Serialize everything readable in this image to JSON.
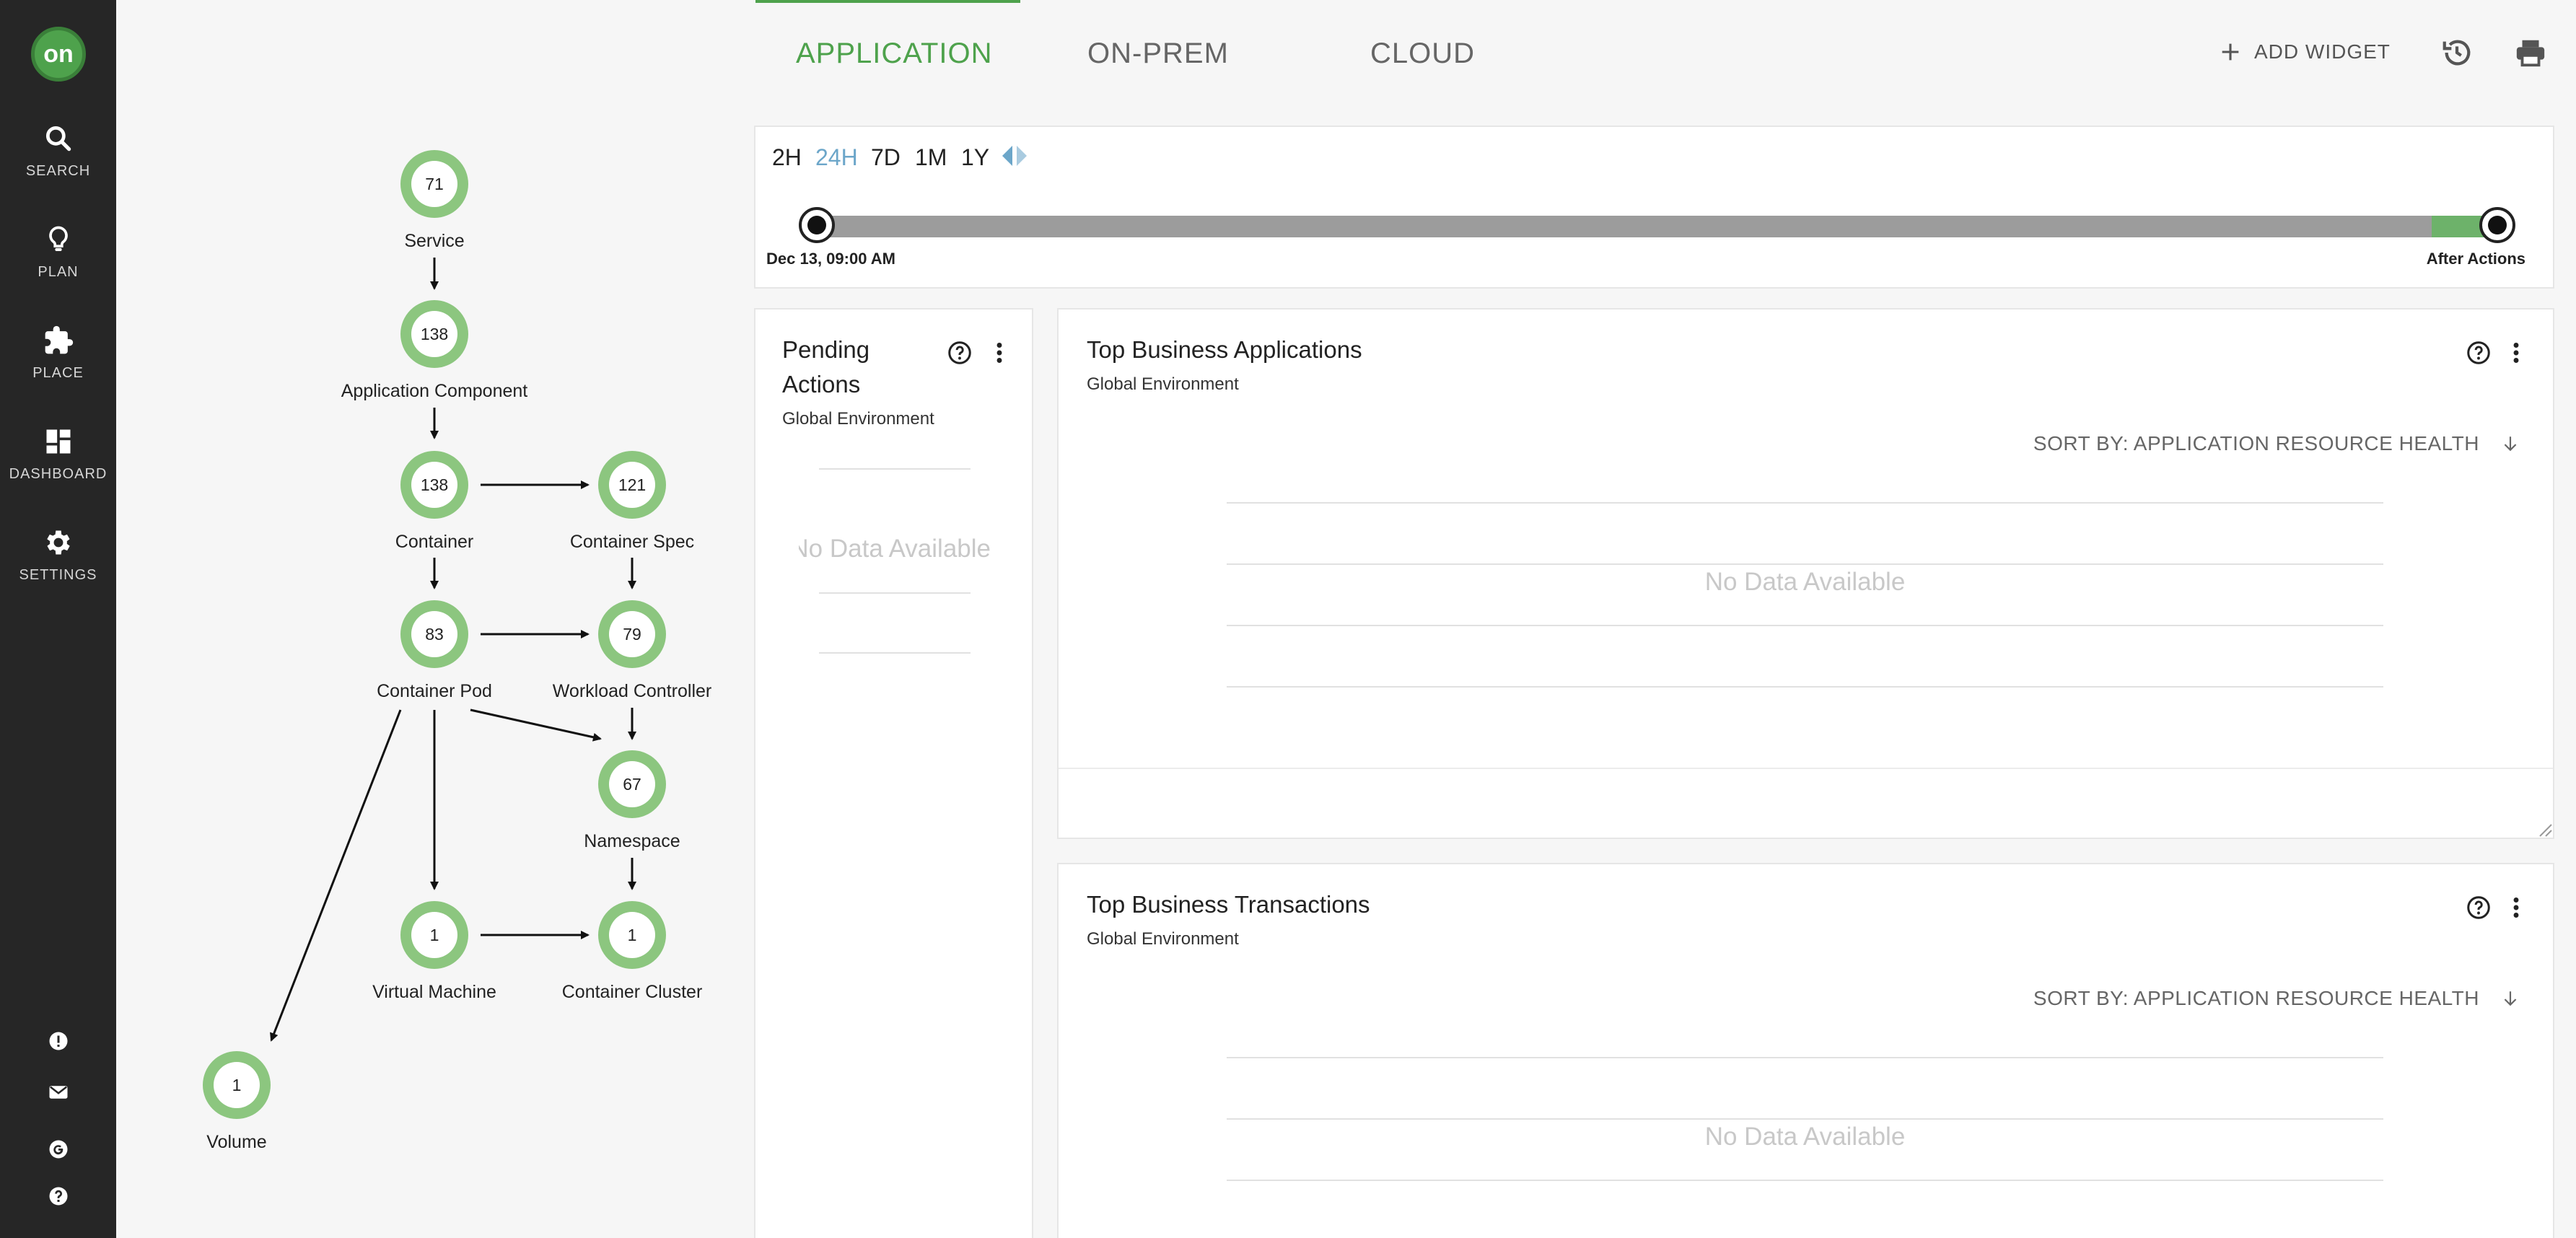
{
  "sidebar": {
    "logo": "on",
    "items": [
      {
        "label": "SEARCH",
        "icon": "search-icon"
      },
      {
        "label": "PLAN",
        "icon": "lightbulb-icon"
      },
      {
        "label": "PLACE",
        "icon": "puzzle-icon"
      },
      {
        "label": "DASHBOARD",
        "icon": "dashboard-icon"
      },
      {
        "label": "SETTINGS",
        "icon": "gear-icon"
      }
    ],
    "footer_icons": [
      "alert-icon",
      "mail-icon",
      "google-icon",
      "help-icon"
    ]
  },
  "header": {
    "tabs": [
      {
        "label": "APPLICATION",
        "active": true
      },
      {
        "label": "ON-PREM",
        "active": false
      },
      {
        "label": "CLOUD",
        "active": false
      }
    ],
    "add_widget": "ADD WIDGET",
    "icons": [
      "history-icon",
      "print-icon"
    ]
  },
  "supply_chain": {
    "nodes": [
      {
        "count": "71",
        "label": "Service"
      },
      {
        "count": "138",
        "label": "Application Component"
      },
      {
        "count": "138",
        "label": "Container"
      },
      {
        "count": "121",
        "label": "Container Spec"
      },
      {
        "count": "83",
        "label": "Container Pod"
      },
      {
        "count": "79",
        "label": "Workload Controller"
      },
      {
        "count": "67",
        "label": "Namespace"
      },
      {
        "count": "1",
        "label": "Virtual Machine"
      },
      {
        "count": "1",
        "label": "Container Cluster"
      },
      {
        "count": "1",
        "label": "Volume"
      }
    ]
  },
  "timeline": {
    "ranges": [
      "2H",
      "24H",
      "7D",
      "1M",
      "1Y"
    ],
    "selected_range": "24H",
    "start_label": "Dec 13, 09:00 AM",
    "end_label": "After Actions"
  },
  "widgets": {
    "pending_actions": {
      "title_line1": "Pending",
      "title_line2": "Actions",
      "subtitle": "Global Environment",
      "empty": "No Data Available"
    },
    "top_business_applications": {
      "title": "Top Business Applications",
      "subtitle": "Global Environment",
      "sort": "SORT BY: APPLICATION RESOURCE HEALTH",
      "empty": "No Data Available"
    },
    "top_business_transactions": {
      "title": "Top Business Transactions",
      "subtitle": "Global Environment",
      "sort": "SORT BY: APPLICATION RESOURCE HEALTH",
      "empty": "No Data Available"
    }
  },
  "colors": {
    "accent": "#4ea24c",
    "node_ring": "#8cc67f",
    "sidebar": "#262626",
    "selected_range": "#6ca6c9"
  }
}
